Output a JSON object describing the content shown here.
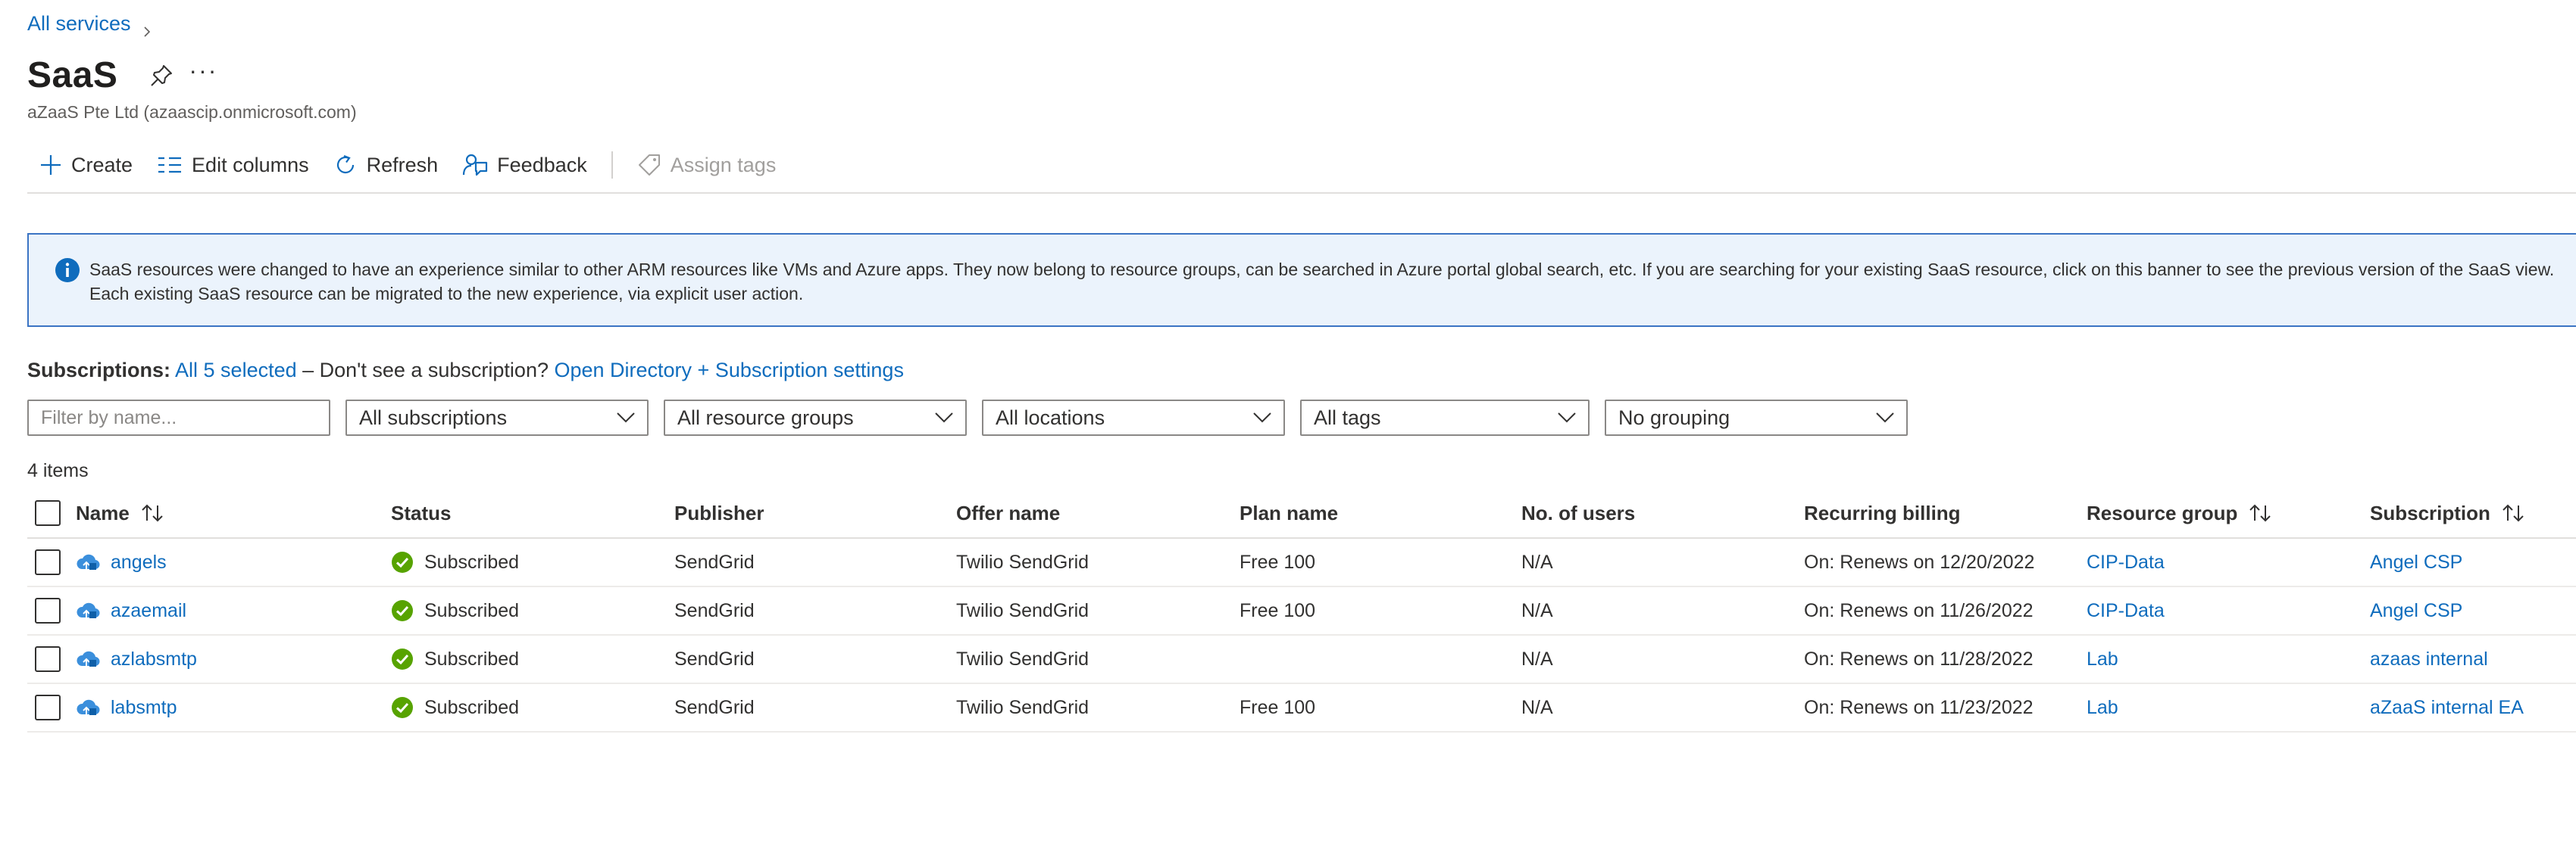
{
  "breadcrumb": {
    "root_label": "All services"
  },
  "header": {
    "title": "SaaS",
    "more_label": "···",
    "subtitle": "aZaaS Pte Ltd (azaascip.onmicrosoft.com)"
  },
  "toolbar": {
    "create_label": "Create",
    "edit_columns_label": "Edit columns",
    "refresh_label": "Refresh",
    "feedback_label": "Feedback",
    "assign_tags_label": "Assign tags"
  },
  "banner": {
    "text": "SaaS resources were changed to have an experience similar to other ARM resources like VMs and Azure apps. They now belong to resource groups, can be searched in Azure portal global search, etc. If you are searching for your existing SaaS resource, click on this banner to see the previous version of the SaaS view. Each existing SaaS resource can be migrated to the new experience, via explicit user action."
  },
  "subscriptions": {
    "label": "Subscriptions:",
    "selected_link": "All 5 selected",
    "middle_text": " – Don't see a subscription? ",
    "settings_link": "Open Directory + Subscription settings"
  },
  "filters": {
    "name_placeholder": "Filter by name...",
    "subscriptions": "All subscriptions",
    "resource_groups": "All resource groups",
    "locations": "All locations",
    "tags": "All tags",
    "grouping": "No grouping"
  },
  "item_count": "4 items",
  "columns": {
    "name": "Name",
    "status": "Status",
    "publisher": "Publisher",
    "offer": "Offer name",
    "plan": "Plan name",
    "users": "No. of users",
    "billing": "Recurring billing",
    "resource_group": "Resource group",
    "subscription": "Subscription"
  },
  "rows": [
    {
      "name": "angels",
      "status": "Subscribed",
      "publisher": "SendGrid",
      "offer": "Twilio SendGrid",
      "plan": "Free 100",
      "users": "N/A",
      "billing": "On: Renews on 12/20/2022",
      "resource_group": "CIP-Data",
      "subscription": "Angel CSP"
    },
    {
      "name": "azaemail",
      "status": "Subscribed",
      "publisher": "SendGrid",
      "offer": "Twilio SendGrid",
      "plan": "Free 100",
      "users": "N/A",
      "billing": "On: Renews on 11/26/2022",
      "resource_group": "CIP-Data",
      "subscription": "Angel CSP"
    },
    {
      "name": "azlabsmtp",
      "status": "Subscribed",
      "publisher": "SendGrid",
      "offer": "Twilio SendGrid",
      "plan": "",
      "users": "N/A",
      "billing": "On: Renews on 11/28/2022",
      "resource_group": "Lab",
      "subscription": "azaas internal"
    },
    {
      "name": "labsmtp",
      "status": "Subscribed",
      "publisher": "SendGrid",
      "offer": "Twilio SendGrid",
      "plan": "Free 100",
      "users": "N/A",
      "billing": "On: Renews on 11/23/2022",
      "resource_group": "Lab",
      "subscription": "aZaaS internal EA"
    }
  ],
  "colors": {
    "link": "#0f6cbd",
    "banner_bg": "#ebf3fc",
    "banner_border": "#3b74c4",
    "status_ok": "#57a300"
  }
}
